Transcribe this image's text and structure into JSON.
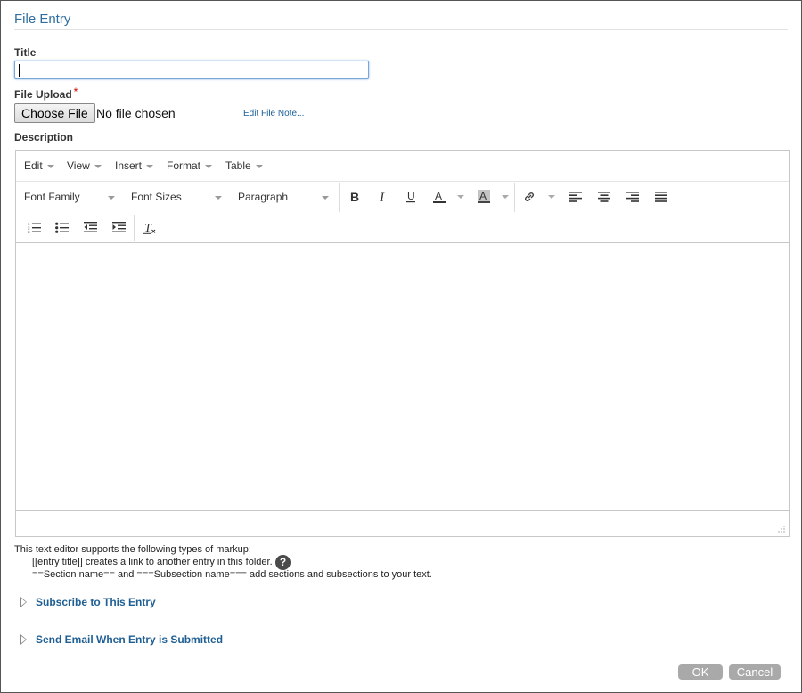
{
  "page": {
    "title": "File Entry"
  },
  "form": {
    "title_label": "Title",
    "title_value": "",
    "file_upload_label": "File Upload",
    "required_mark": "*",
    "choose_file_label": "Choose File",
    "no_file_text": "No file chosen",
    "edit_file_note": "Edit File Note...",
    "description_label": "Description"
  },
  "editor": {
    "menus": [
      "Edit",
      "View",
      "Insert",
      "Format",
      "Table"
    ],
    "font_family": "Font Family",
    "font_sizes": "Font Sizes",
    "paragraph": "Paragraph",
    "icons": {
      "bold": "bold-icon",
      "italic": "italic-icon",
      "underline": "underline-icon",
      "text_color": "text-color-icon",
      "background_color": "background-color-icon",
      "link": "link-icon",
      "align_left": "align-left-icon",
      "align_center": "align-center-icon",
      "align_right": "align-right-icon",
      "justify": "justify-icon",
      "numbered_list": "numbered-list-icon",
      "bullet_list": "bullet-list-icon",
      "outdent": "outdent-icon",
      "indent": "indent-icon",
      "clear_formatting": "clear-formatting-icon"
    },
    "content": ""
  },
  "help": {
    "intro": "This text editor supports the following types of markup:",
    "line1": "[[entry title]] creates a link to another entry in this folder.",
    "line2": "==Section name== and ===Subsection name=== add sections and subsections to your text.",
    "help_icon_text": "?"
  },
  "sections": [
    {
      "label": "Subscribe to This Entry"
    },
    {
      "label": "Send Email When Entry is Submitted"
    }
  ],
  "footer": {
    "ok_label": "OK",
    "cancel_label": "Cancel"
  },
  "colors": {
    "accent": "#2f6f9f",
    "link": "#1f5f93",
    "button_gray": "#a9a9a9"
  }
}
